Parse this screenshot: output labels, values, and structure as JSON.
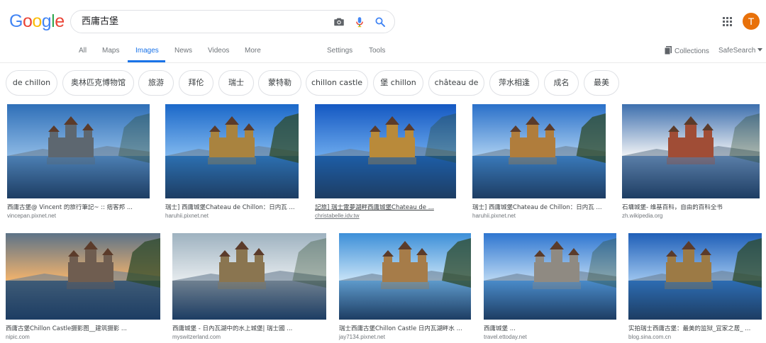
{
  "logo": {
    "letters": [
      "G",
      "o",
      "o",
      "g",
      "l",
      "e"
    ]
  },
  "search": {
    "query": "西庸古堡"
  },
  "colors": {
    "blue": "#4285f4",
    "red": "#ea4335",
    "yellow": "#fbbc05",
    "green": "#34a853",
    "accent": "#1a73e8",
    "avatar": "#e8710a"
  },
  "account": {
    "initial": "T"
  },
  "nav": {
    "tabs": [
      "All",
      "Maps",
      "Images",
      "News",
      "Videos",
      "More"
    ],
    "active": "Images",
    "settings": "Settings",
    "tools": "Tools",
    "collections": "Collections",
    "safesearch": "SafeSearch"
  },
  "chips": [
    "de chillon",
    "奥林匹克博物馆",
    "旅游",
    "拜伦",
    "瑞士",
    "蒙特勒",
    "chillon castle",
    "堡 chillon",
    "château de",
    "萍水相逢",
    "成名",
    "最美"
  ],
  "results": [
    {
      "title": "西庸古堡@ Vincent 的旅行筆記~ :: 痞客邦 ...",
      "source": "vincepan.pixnet.net",
      "visited": false
    },
    {
      "title": "瑞士] 西庸城堡Chateau de Chillon：日内瓦 ...",
      "source": "haruhii.pixnet.net",
      "visited": false
    },
    {
      "title": "記旅] 瑞士雷夢湖畔西庸城堡Chateau de ...",
      "source": "christabelle.idv.tw",
      "visited": true
    },
    {
      "title": "瑞士] 西庸城堡Chateau de Chillon：日内瓦 ...",
      "source": "haruhii.pixnet.net",
      "visited": false
    },
    {
      "title": "石墉城堡- 维基百科，自由的百科全书",
      "source": "zh.wikipedia.org",
      "visited": false
    },
    {
      "title": "西庸古堡Chillon Castle摄影图__建筑摄影 ...",
      "source": "nipic.com",
      "visited": false
    },
    {
      "title": "西庸城堡 - 日內瓦湖中的水上城堡| 瑞士國 ...",
      "source": "myswitzerland.com",
      "visited": false
    },
    {
      "title": "瑞士西庸古堡Chillon Castle 日内瓦湖畔水 ...",
      "source": "jay7134.pixnet.net",
      "visited": false
    },
    {
      "title": "西庸城堡 ...",
      "source": "travel.ettoday.net",
      "visited": false
    },
    {
      "title": "实拍瑞士西庸古堡：最美的监狱_宜家之居_ ...",
      "source": "blog.sina.com.cn",
      "visited": false
    }
  ]
}
